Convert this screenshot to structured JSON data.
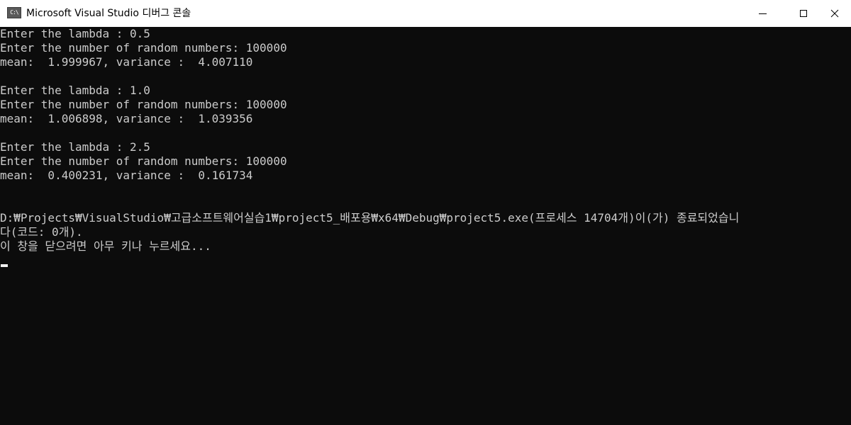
{
  "window": {
    "title": "Microsoft Visual Studio 디버그 콘솔",
    "icon_label": "C:\\"
  },
  "console": {
    "lines": [
      "Enter the lambda : 0.5",
      "Enter the number of random numbers: 100000",
      "mean:  1.999967, variance :  4.007110",
      "",
      "Enter the lambda : 1.0",
      "Enter the number of random numbers: 100000",
      "mean:  1.006898, variance :  1.039356",
      "",
      "Enter the lambda : 2.5",
      "Enter the number of random numbers: 100000",
      "mean:  0.400231, variance :  0.161734",
      "",
      "",
      "D:₩Projects₩VisualStudio₩고급소프트웨어실습1₩project5_배포용₩x64₩Debug₩project5.exe(프로세스 14704개)이(가) 종료되었습니",
      "다(코드: 0개).",
      "이 창을 닫으려면 아무 키나 누르세요..."
    ]
  }
}
